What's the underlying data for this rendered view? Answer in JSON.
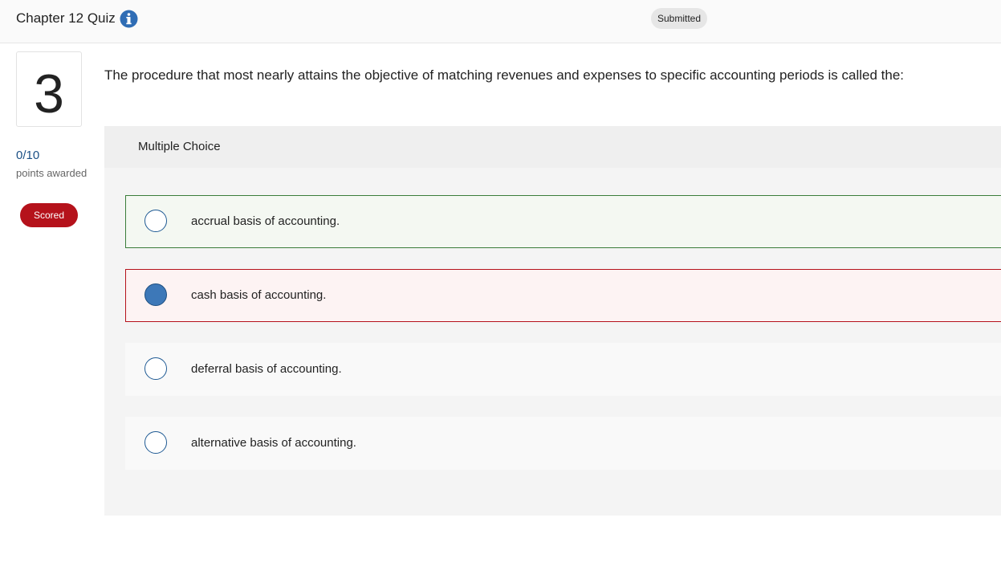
{
  "header": {
    "title": "Chapter 12 Quiz",
    "info_icon": "info-circle-icon",
    "status": "Submitted"
  },
  "question": {
    "number": "3",
    "score": "0/10",
    "points_label": "points awarded",
    "scored_label": "Scored",
    "text": "The procedure that most nearly attains the objective of matching revenues and expenses to specific accounting periods is called the:",
    "type_label": "Multiple Choice",
    "options": [
      {
        "label": "accrual basis of accounting.",
        "state": "correct",
        "selected": false
      },
      {
        "label": "cash basis of accounting.",
        "state": "incorrect",
        "selected": true
      },
      {
        "label": "deferral basis of accounting.",
        "state": "neutral",
        "selected": false
      },
      {
        "label": "alternative basis of accounting.",
        "state": "neutral",
        "selected": false
      }
    ]
  },
  "colors": {
    "accent": "#1f5a94",
    "correct_border": "#3a7d3a",
    "incorrect_border": "#b5121b",
    "scored_badge": "#b5121b",
    "selected_radio": "#3d78b8"
  }
}
